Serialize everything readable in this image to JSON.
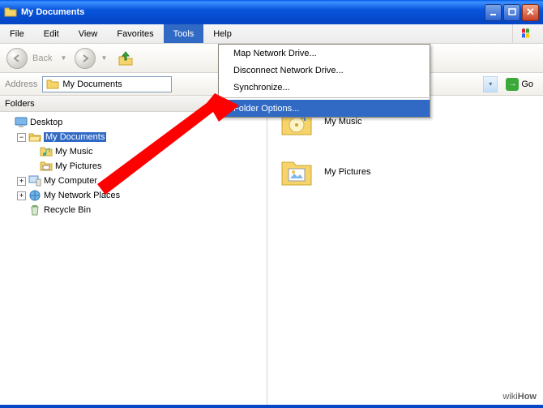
{
  "window": {
    "title": "My Documents"
  },
  "menu": {
    "file": "File",
    "edit": "Edit",
    "view": "View",
    "favorites": "Favorites",
    "tools": "Tools",
    "help": "Help"
  },
  "toolbar": {
    "back": "Back"
  },
  "address": {
    "label": "Address",
    "value": "My Documents",
    "go": "Go"
  },
  "folders": {
    "header": "Folders",
    "tree": {
      "desktop": "Desktop",
      "mydocs": "My Documents",
      "mymusic": "My Music",
      "mypics": "My Pictures",
      "mycomp": "My Computer",
      "netplaces": "My Network Places",
      "recycle": "Recycle Bin"
    }
  },
  "files": {
    "mymusic": "My Music",
    "mypics": "My Pictures"
  },
  "dropdown": {
    "map": "Map Network Drive...",
    "disc": "Disconnect Network Drive...",
    "sync": "Synchronize...",
    "folderopts": "Folder Options..."
  },
  "watermark": {
    "wiki": "wiki",
    "how": "How"
  }
}
